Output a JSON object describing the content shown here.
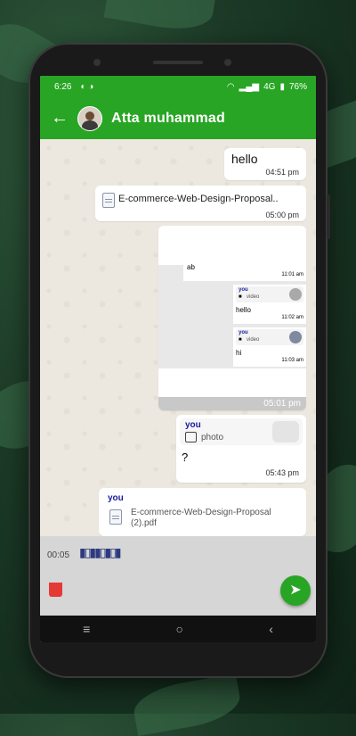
{
  "status": {
    "time": "6:26",
    "network": "4G",
    "battery": "76%"
  },
  "header": {
    "title": "Atta muhammad"
  },
  "messages": {
    "m1": {
      "text": "hello",
      "time": "04:51 pm"
    },
    "m2": {
      "filename": "E-commerce-Web-Design-Proposal..",
      "time": "05:00 pm"
    },
    "m3": {
      "inner_fragment": "ab",
      "inner_time1": "11:01 am",
      "reply1_you": "you",
      "reply1_type": "video",
      "reply1_text": "hello",
      "reply1_time": "11:02 am",
      "reply2_you": "you",
      "reply2_type": "video",
      "reply2_text": "hi",
      "reply2_time": "11:03 am",
      "time": "05:01 pm"
    },
    "m4": {
      "you": "you",
      "type": "photo",
      "text": "?",
      "time": "05:43 pm"
    },
    "m5": {
      "you": "you",
      "filename": "E-commerce-Web-Design-Proposal (2).pdf"
    }
  },
  "recorder": {
    "duration": "00:05"
  },
  "icons": [
    "back-arrow-icon",
    "file-icon",
    "video-icon",
    "photo-icon",
    "waveform-icon",
    "trash-icon",
    "send-icon",
    "nav-menu-icon",
    "nav-home-icon",
    "nav-back-icon"
  ],
  "colors": {
    "brand": "#28a524",
    "delete": "#e53935"
  }
}
